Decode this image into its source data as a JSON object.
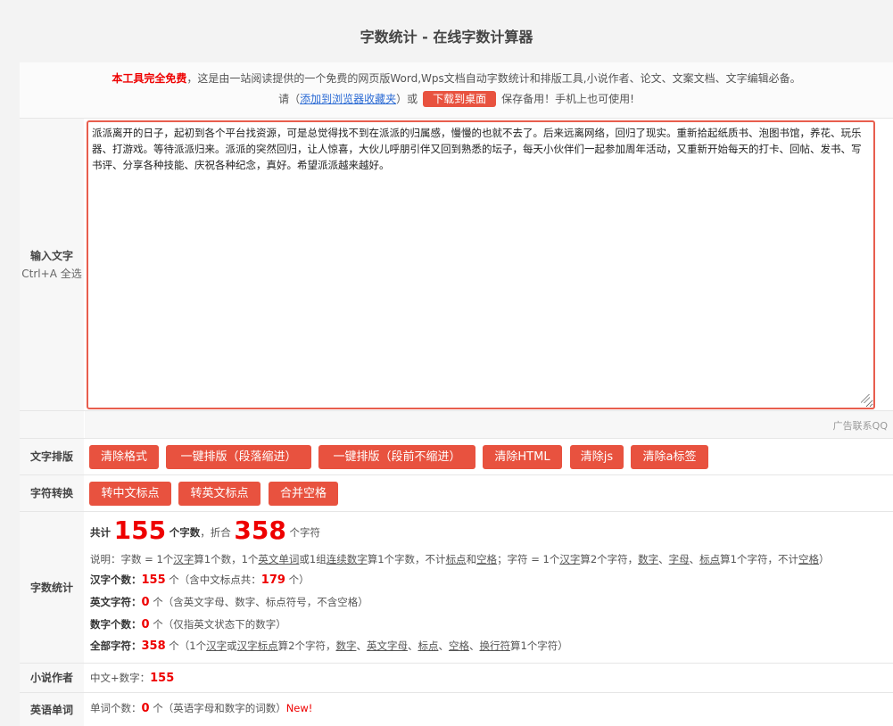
{
  "page": {
    "title": "字数统计 - 在线字数计算器"
  },
  "notice": {
    "free": "本工具完全免费",
    "desc": "，这是由一站阅读提供的一个免费的网页版Word,Wps文档自动字数统计和排版工具,小说作者、论文、文案文档、文字编辑必备。",
    "please": "请（",
    "bookmark_link": "添加到浏览器收藏夹",
    "or": "）或",
    "download_btn": "下载到桌面",
    "save": "保存备用！手机上也可使用!"
  },
  "input": {
    "label": "输入文字",
    "hint": "Ctrl+A 全选",
    "text": "派派离开的日子，起初到各个平台找资源，可是总觉得找不到在派派的归属感，慢慢的也就不去了。后来远离网络，回归了现实。重新拾起纸质书、泡图书馆，养花、玩乐器、打游戏。等待派派归来。派派的突然回归，让人惊喜，大伙儿呼朋引伴又回到熟悉的坛子，每天小伙伴们一起参加周年活动，又重新开始每天的打卡、回帖、发书、写书评、分享各种技能、庆祝各种纪念，真好。希望派派越来越好。"
  },
  "ad": {
    "text": "广告联系QQ"
  },
  "layout_row": {
    "label": "文字排版",
    "buttons": [
      "清除格式",
      "一键排版（段落缩进）",
      "一键排版（段前不缩进）",
      "清除HTML",
      "清除js",
      "清除a标签"
    ]
  },
  "convert_row": {
    "label": "字符转换",
    "buttons": [
      "转中文标点",
      "转英文标点",
      "合并空格"
    ]
  },
  "stats": {
    "label": "字数统计",
    "total_prefix": "共计",
    "word_count": "155",
    "word_unit": "个字数",
    "equiv": "，折合",
    "char_count": "358",
    "char_unit": "个字符",
    "explain": {
      "a": "说明：字数 = 1个",
      "hanzi": "汉字",
      "b": "算1个数，1个",
      "en_word": "英文单词",
      "c": "或1组",
      "cont_num": "连续数字",
      "d": "算1个字数，不计",
      "punct": "标点",
      "e": "和",
      "space": "空格",
      "f": "；字符 = 1个",
      "hanzi2": "汉字",
      "g": "算2个字符，",
      "digit": "数字",
      "h": "、",
      "letter": "字母",
      "i": "、",
      "punct2": "标点",
      "j": "算1个字符，不计",
      "space2": "空格",
      "k": "）"
    },
    "han_label": "汉字个数：",
    "han_count": "155",
    "han_unit": "个（含中文标点共：",
    "han_punct_count": "179",
    "han_tail": "个）",
    "en_label": "英文字符：",
    "en_count": "0",
    "en_tail": "个（含英文字母、数字、标点符号，不含空格）",
    "num_label": "数字个数：",
    "num_count": "0",
    "num_tail": "个（仅指英文状态下的数字）",
    "all_label": "全部字符：",
    "all_count": "358",
    "all_a": "个（1个",
    "all_hanzi": "汉字",
    "all_or": "或",
    "all_hanpunct": "汉字标点",
    "all_b": "算2个字符，",
    "all_digit": "数字",
    "all_sep1": "、",
    "all_enletter": "英文字母",
    "all_sep2": "、",
    "all_punct": "标点",
    "all_sep3": "、",
    "all_space": "空格",
    "all_sep4": "、",
    "all_newline": "换行符",
    "all_c": "算1个字符）"
  },
  "novel": {
    "label": "小说作者",
    "text": "中文+数字：",
    "count": "155"
  },
  "english": {
    "label": "英语单词",
    "text": "单词个数：",
    "count": "0",
    "tail": "个（英语字母和数字的词数）",
    "new": "New!"
  }
}
